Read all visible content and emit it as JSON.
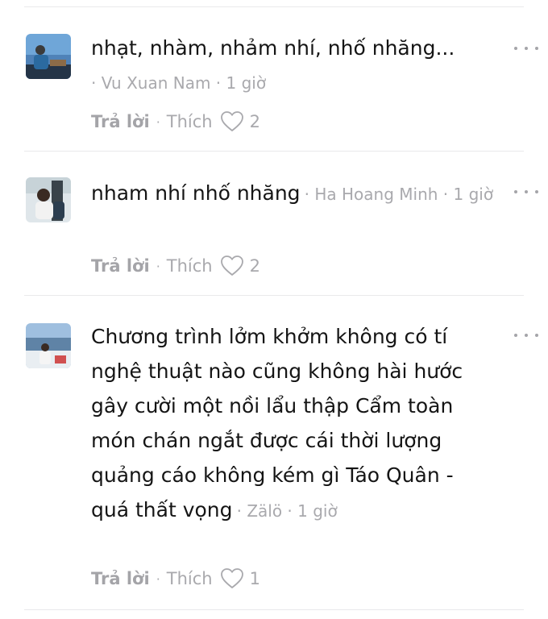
{
  "comments": [
    {
      "text": "nhạt, nhàm, nhảm nhí, nhố nhăng...",
      "meta": "· Vu Xuan Nam · 1 giờ",
      "reply_label": "Trả lời",
      "separator": "·",
      "like_label": "Thích",
      "like_count": "2"
    },
    {
      "text": "nham nhí nhố nhăng",
      "meta": "· Ha Hoang Minh · 1 giờ",
      "reply_label": "Trả lời",
      "separator": "·",
      "like_label": "Thích",
      "like_count": "2"
    },
    {
      "text": "Chương trình lởm khởm không có tí nghệ thuật nào cũng không hài hước gây cười một nồi lẩu thập Cẩm toàn món chán ngắt được cái thời lượng quảng cáo không kém gì Táo Quân - quá thất vọng",
      "meta": "· Zälö · 1 giờ",
      "reply_label": "Trả lời",
      "separator": "·",
      "like_label": "Thích",
      "like_count": "1"
    }
  ],
  "colors": {
    "text": "#151515",
    "meta": "#a9a9ad",
    "divider": "#e9e9eb"
  },
  "icons": {
    "more": "more-horizontal-icon",
    "like": "heart-outline-icon"
  }
}
